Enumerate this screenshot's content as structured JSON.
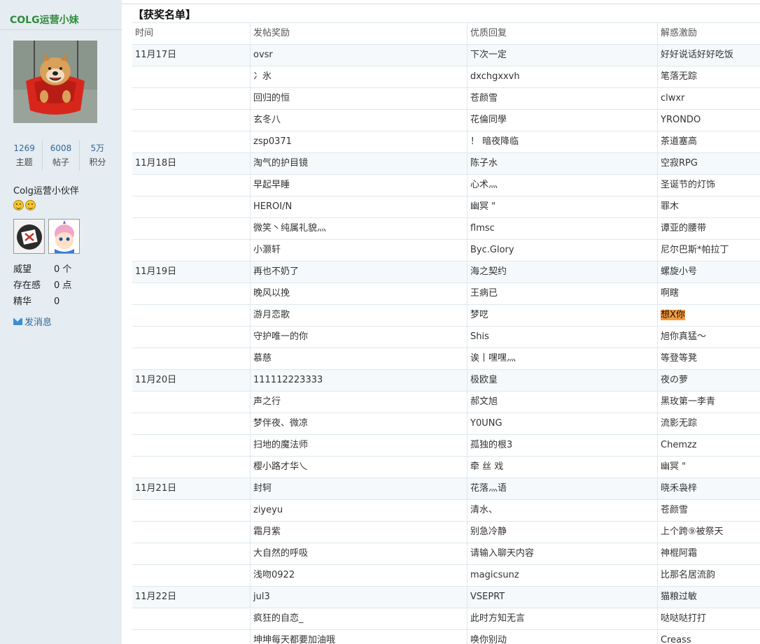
{
  "sidebar": {
    "username": "COLG运营小妹",
    "stats": [
      {
        "num": "1269",
        "label": "主题"
      },
      {
        "num": "6008",
        "label": "帖子"
      },
      {
        "num": "5万",
        "label": "积分"
      }
    ],
    "usergroup": "Colg运营小伙伴",
    "info": [
      {
        "key": "威望",
        "val": "0 个"
      },
      {
        "key": "存在感",
        "val": "0 点"
      },
      {
        "key": "精华",
        "val": "0"
      }
    ],
    "send_message": "发消息"
  },
  "main": {
    "title": "【获奖名单】",
    "headers": [
      "时间",
      "发帖奖励",
      "优质回复",
      "解惑激励"
    ],
    "rows": [
      [
        "11月17日",
        "ovsr",
        "下次一定",
        "好好说话好好吃饭"
      ],
      [
        "",
        "冫氷",
        "dxchgxxvh",
        "笔落无踪"
      ],
      [
        "",
        "回归的恒",
        "苍颜雪",
        "clwxr"
      ],
      [
        "",
        "玄冬八",
        "花倫同學",
        "YRONDO"
      ],
      [
        "",
        "zsp0371",
        "！ 暗夜降临",
        "茶道塞高"
      ],
      [
        "11月18日",
        "淘气的护目镜",
        "陈子水",
        "空寂RPG"
      ],
      [
        "",
        "早起早睡",
        "心术灬",
        "圣诞节的灯饰"
      ],
      [
        "",
        "HEROI/N",
        "幽冥 \"",
        "罪木"
      ],
      [
        "",
        "微笑丶纯属礼貌灬",
        "flmsc",
        "谭亚的腰带"
      ],
      [
        "",
        "小灏轩",
        "Byc.Glory",
        "尼尔巴斯*帕拉丁"
      ],
      [
        "11月19日",
        "再也不奶了",
        "海之契约",
        "螺旋小号"
      ],
      [
        "",
        "晚风以挽",
        "王病已",
        "啊瞎"
      ],
      [
        "",
        "游月恋歌",
        "梦呓",
        "想X你"
      ],
      [
        "",
        "守护唯一的你",
        "Shis",
        "旭你真猛～"
      ],
      [
        "",
        "慕慈",
        "诶丨嘿嘿灬",
        "等登等凳"
      ],
      [
        "11月20日",
        "111112223333",
        "极欧皇",
        "夜の萝"
      ],
      [
        "",
        "声之行",
        "郝文旭",
        "黑玫第一李青"
      ],
      [
        "",
        "梦伴夜、微凉",
        "Y0UNG",
        "流影无踪"
      ],
      [
        "",
        "扫地的魔法师",
        "孤独的根3",
        "Chemzz"
      ],
      [
        "",
        "樱小路才华乀",
        "牵 丝 戏",
        "幽冥 \""
      ],
      [
        "11月21日",
        "封轲",
        "花落灬语",
        "晓禾袅梓"
      ],
      [
        "",
        "ziyeyu",
        "清水、",
        "苍颜雪"
      ],
      [
        "",
        "霜月紫",
        "别急冷静",
        "上个跨⑨被祭天"
      ],
      [
        "",
        "大自然的呼吸",
        "请输入聊天内容",
        "神棍阿霜"
      ],
      [
        "",
        "浅吻0922",
        "magicsunz",
        "比那名居流韵"
      ],
      [
        "11月22日",
        "jul3",
        "VSEPRT",
        "猫粮过敏"
      ],
      [
        "",
        "疯狂的自恋_",
        "此时方知无言",
        "哒哒哒打打"
      ],
      [
        "",
        "坤坤每天都要加油哦",
        "唤你别动",
        "Creass"
      ]
    ],
    "highlight_color": "#f79a3e"
  }
}
